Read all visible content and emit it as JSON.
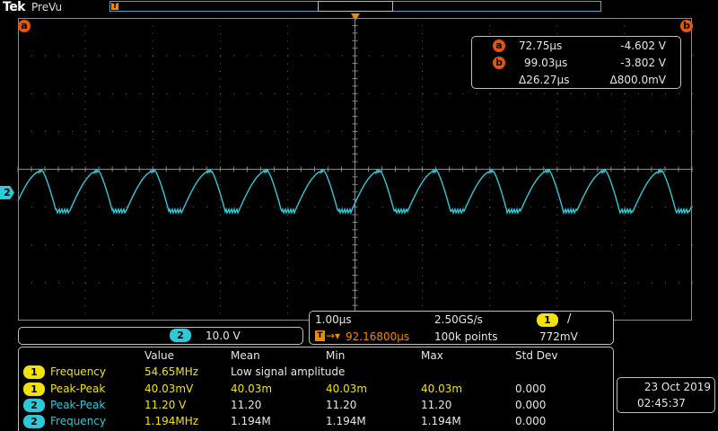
{
  "header": {
    "logo": "Tek",
    "acq_state": "PreVu"
  },
  "cursors": {
    "a_label": "a",
    "b_label": "b",
    "rows": [
      {
        "label": "a",
        "time": "72.75µs",
        "volt": "-4.602 V"
      },
      {
        "label": "b",
        "time": "99.03µs",
        "volt": "-3.802 V"
      }
    ],
    "delta_time": "Δ26.27µs",
    "delta_volt": "Δ800.0mV"
  },
  "channel": {
    "label": "2",
    "scale": "10.0 V"
  },
  "horizontal": {
    "time_div": "1.00µs",
    "sample_rate": "2.50GS/s",
    "trig_channel": "1",
    "trig_slope": "/",
    "trig_delay": "92.16800µs",
    "record_length": "100k points",
    "trig_level": "772mV"
  },
  "measurements": {
    "headers": [
      "Value",
      "Mean",
      "Min",
      "Max",
      "Std Dev"
    ],
    "rows": [
      {
        "ch": "1",
        "name": "Frequency",
        "value": "54.65MHz",
        "mean": "Low signal amplitude",
        "min": "",
        "max": "",
        "std": ""
      },
      {
        "ch": "1",
        "name": "Peak-Peak",
        "value": "40.03mV",
        "mean": "40.03m",
        "min": "40.03m",
        "max": "40.03m",
        "std": "0.000"
      },
      {
        "ch": "2",
        "name": "Peak-Peak",
        "value": "11.20 V",
        "mean": "11.20",
        "min": "11.20",
        "max": "11.20",
        "std": "0.000"
      },
      {
        "ch": "2",
        "name": "Frequency",
        "value": "1.194MHz",
        "mean": "1.194M",
        "min": "1.194M",
        "max": "1.194M",
        "std": "0.000"
      }
    ]
  },
  "datetime": {
    "date": "23 Oct  2019",
    "time": "02:45:37"
  },
  "colors": {
    "ch1": "#f2e20a",
    "ch2": "#2ec9d6",
    "cursor": "#e8540a",
    "trigger": "#f08a00",
    "grid": "#8a8a8a"
  },
  "icons": {
    "trigger_marker": "trigger-position-icon",
    "channel_marker": "ch2-ground-marker-icon"
  },
  "waveform": {
    "channel": "2",
    "period_divisions": 0.836,
    "shape": "triangle-sawtooth"
  }
}
